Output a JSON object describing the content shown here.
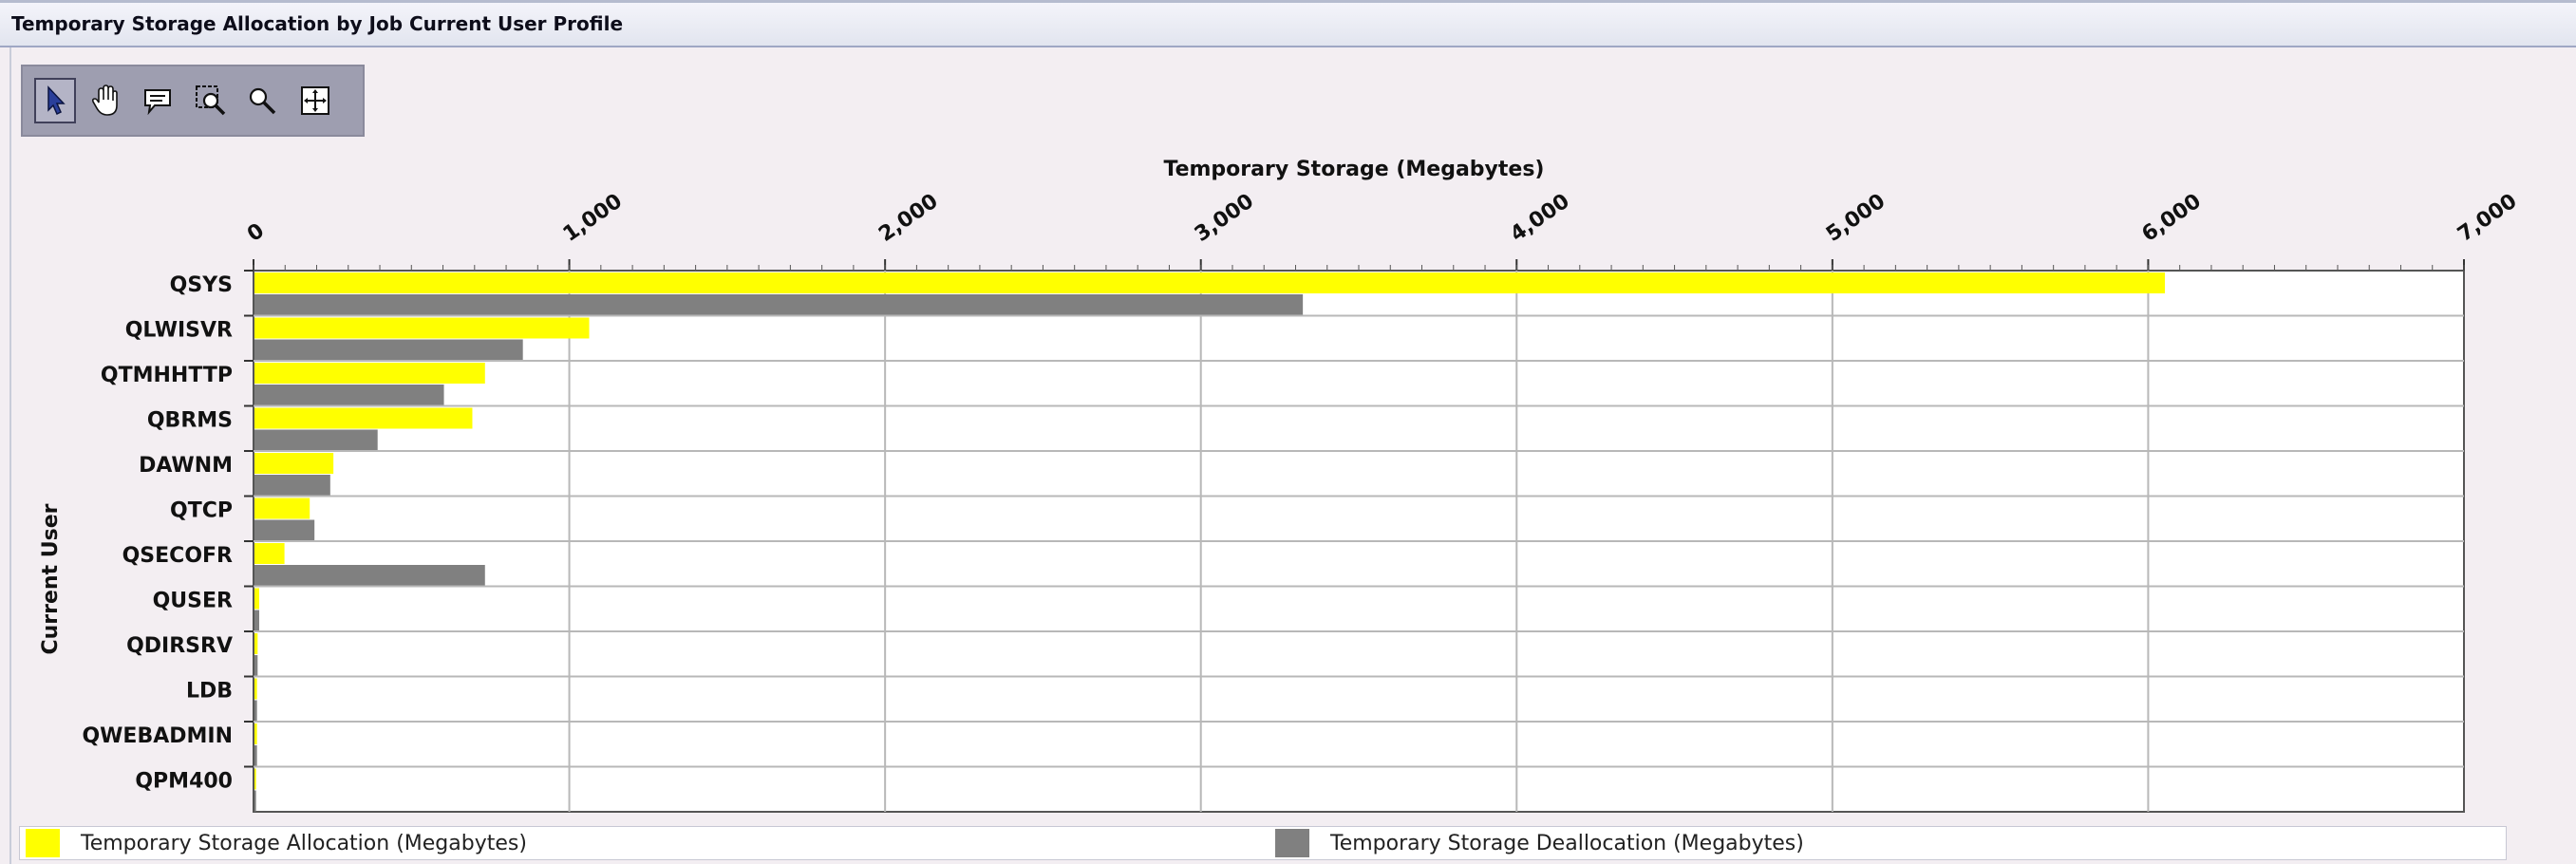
{
  "window": {
    "title": "Temporary Storage Allocation by Job Current User Profile"
  },
  "toolbar": {
    "tools": [
      {
        "name": "select-pointer-icon",
        "selected": true
      },
      {
        "name": "pan-hand-icon",
        "selected": false
      },
      {
        "name": "tooltip-icon",
        "selected": false
      },
      {
        "name": "zoom-box-icon",
        "selected": false
      },
      {
        "name": "zoom-magnifier-icon",
        "selected": false
      },
      {
        "name": "fit-crosshair-icon",
        "selected": false
      }
    ]
  },
  "chart_data": {
    "type": "bar",
    "orientation": "horizontal",
    "title": "",
    "xlabel": "Temporary Storage (Megabytes)",
    "ylabel": "Current User",
    "xlim": [
      0,
      7000
    ],
    "x_ticks": [
      "0",
      "1,000",
      "2,000",
      "3,000",
      "4,000",
      "5,000",
      "6,000",
      "7,000"
    ],
    "x_axis_position": "top",
    "grid": true,
    "legend_position": "bottom",
    "categories": [
      "QSYS",
      "QLWISVR",
      "QTMHHTTP",
      "QBRMS",
      "DAWNM",
      "QTCP",
      "QSECOFR",
      "QUSER",
      "QDIRSRV",
      "LDB",
      "QWEBADMIN",
      "QPM400"
    ],
    "series": [
      {
        "name": "Temporary Storage Allocation (Megabytes)",
        "color": "#ffff00",
        "values": [
          6050,
          1060,
          730,
          690,
          250,
          175,
          95,
          15,
          10,
          8,
          8,
          5
        ]
      },
      {
        "name": "Temporary Storage Deallocation (Megabytes)",
        "color": "#808080",
        "values": [
          3320,
          850,
          600,
          390,
          240,
          190,
          730,
          15,
          10,
          8,
          8,
          5
        ]
      }
    ]
  },
  "legend": {
    "allocation_label": "Temporary Storage Allocation (Megabytes)",
    "deallocation_label": "Temporary Storage Deallocation (Megabytes)"
  }
}
